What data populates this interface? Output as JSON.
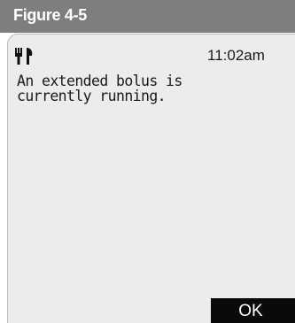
{
  "figure": {
    "label": "Figure 4-5"
  },
  "status_bar": {
    "icon": "bolus-icon",
    "time": "11:02am"
  },
  "message": {
    "text": "An extended bolus is\ncurrently running."
  },
  "actions": {
    "ok_label": "OK"
  },
  "colors": {
    "figure_bar": "#7d7e80",
    "screen_background": "#ececec",
    "button_background": "#0a0a0a",
    "button_text": "#ffffff"
  }
}
